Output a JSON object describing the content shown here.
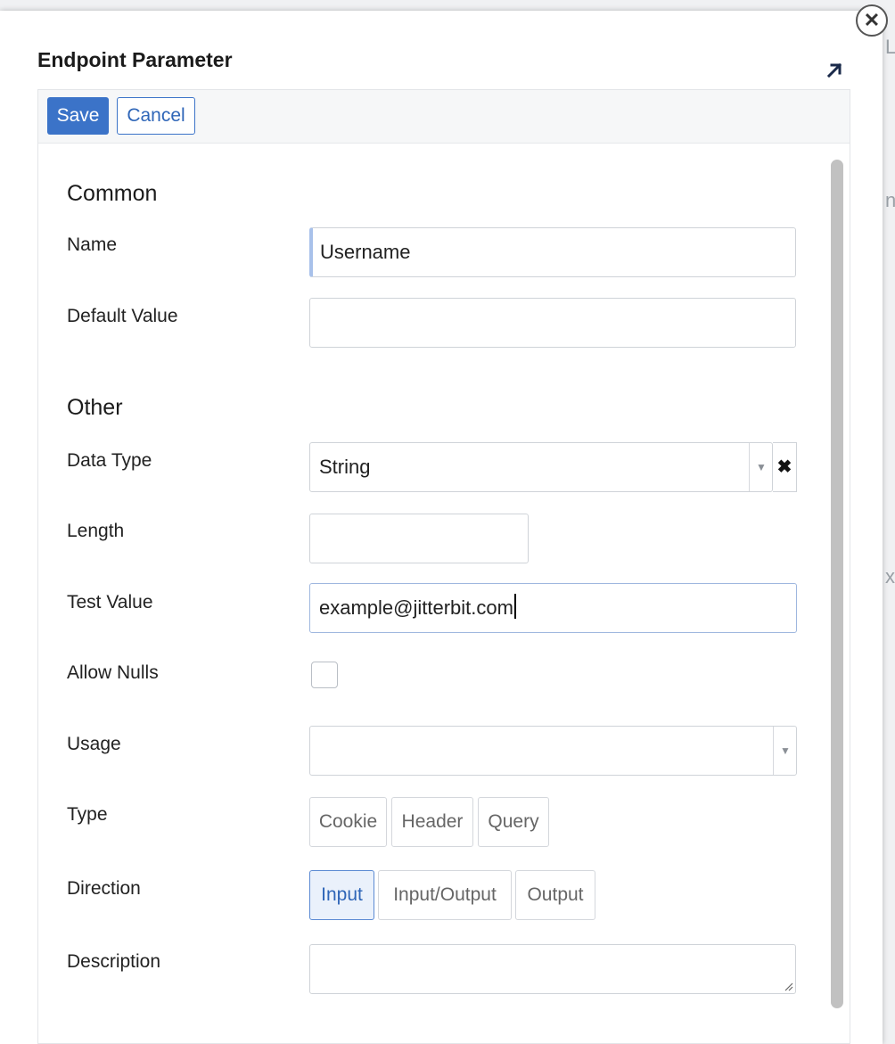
{
  "dialog": {
    "title": "Endpoint Parameter"
  },
  "toolbar": {
    "save_label": "Save",
    "cancel_label": "Cancel"
  },
  "sections": {
    "common": "Common",
    "other": "Other"
  },
  "fields": {
    "name": {
      "label": "Name",
      "value": "Username"
    },
    "default_value": {
      "label": "Default Value",
      "value": ""
    },
    "data_type": {
      "label": "Data Type",
      "selected": "String"
    },
    "length": {
      "label": "Length",
      "value": ""
    },
    "test_value": {
      "label": "Test Value",
      "value": "example@jitterbit.com"
    },
    "allow_nulls": {
      "label": "Allow Nulls",
      "checked": false
    },
    "usage": {
      "label": "Usage",
      "selected": ""
    },
    "type": {
      "label": "Type",
      "options": [
        "Cookie",
        "Header",
        "Query"
      ]
    },
    "direction": {
      "label": "Direction",
      "options": [
        "Input",
        "Input/Output",
        "Output"
      ],
      "selected": "Input"
    },
    "description": {
      "label": "Description",
      "value": ""
    }
  },
  "icons": {
    "close": "close-icon",
    "popout": "popout-arrow-icon",
    "dropdown": "chevron-down-icon",
    "clear": "clear-x-icon"
  },
  "colors": {
    "primary": "#3b73c8",
    "active_segment_bg": "#eaf1fb"
  }
}
